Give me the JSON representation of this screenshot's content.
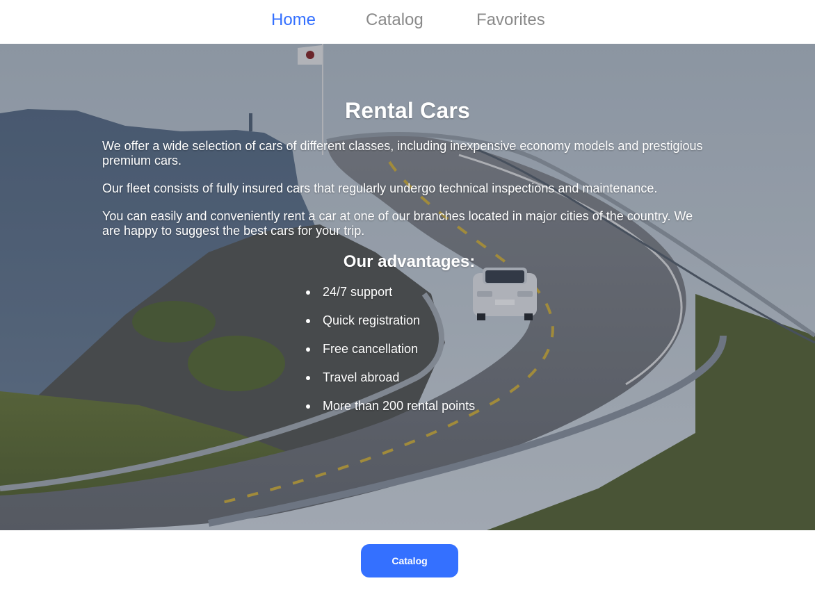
{
  "nav": {
    "items": [
      {
        "label": "Home",
        "active": true
      },
      {
        "label": "Catalog",
        "active": false
      },
      {
        "label": "Favorites",
        "active": false
      }
    ]
  },
  "hero": {
    "title": "Rental Cars",
    "paragraphs": [
      "We offer a wide selection of cars of different classes, including inexpensive economy models and prestigious premium cars.",
      "Our fleet consists of fully insured cars that regularly undergo technical inspections and maintenance.",
      "You can easily and conveniently rent a car at one of our branches located in major cities of the country. We are happy to suggest the best cars for your trip."
    ],
    "advantages_title": "Our advantages:",
    "advantages": [
      "24/7 support",
      "Quick registration",
      "Free cancellation",
      "Travel abroad",
      "More than 200 rental points"
    ]
  },
  "footer": {
    "catalog_button": "Catalog"
  },
  "colors": {
    "accent": "#3470ff",
    "nav_inactive": "#8a8a8a",
    "text_on_image": "#ffffff"
  }
}
